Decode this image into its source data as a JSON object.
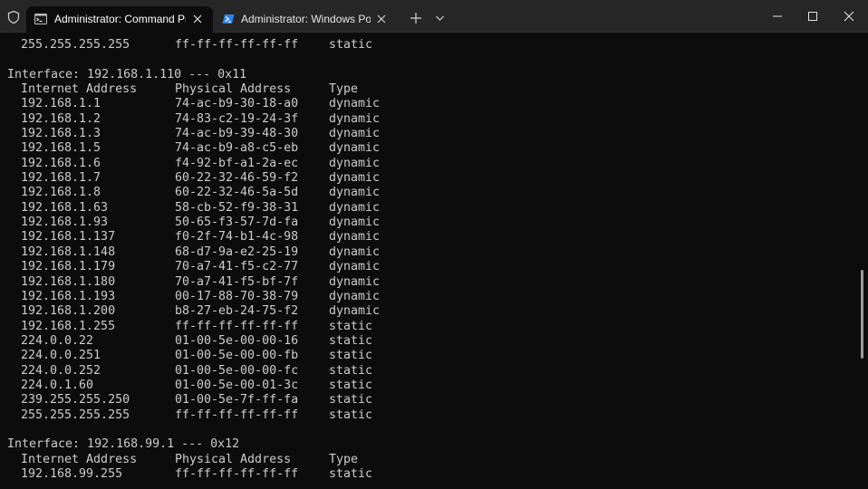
{
  "tabs": [
    {
      "title": "Administrator: Command Pro",
      "icon": "cmd-icon"
    },
    {
      "title": "Administrator: Windows PowerShell",
      "icon": "powershell-icon"
    }
  ],
  "terminal": {
    "lines": [
      {
        "type": "row",
        "cells": [
          "255.255.255.255",
          "ff-ff-ff-ff-ff-ff",
          "static"
        ]
      },
      {
        "type": "blank"
      },
      {
        "type": "text",
        "text": "Interface: 192.168.1.110 --- 0x11"
      },
      {
        "type": "row",
        "cells": [
          "Internet Address",
          "Physical Address",
          "Type"
        ]
      },
      {
        "type": "row",
        "cells": [
          "192.168.1.1",
          "74-ac-b9-30-18-a0",
          "dynamic"
        ]
      },
      {
        "type": "row",
        "cells": [
          "192.168.1.2",
          "74-83-c2-19-24-3f",
          "dynamic"
        ]
      },
      {
        "type": "row",
        "cells": [
          "192.168.1.3",
          "74-ac-b9-39-48-30",
          "dynamic"
        ]
      },
      {
        "type": "row",
        "cells": [
          "192.168.1.5",
          "74-ac-b9-a8-c5-eb",
          "dynamic"
        ]
      },
      {
        "type": "row",
        "cells": [
          "192.168.1.6",
          "f4-92-bf-a1-2a-ec",
          "dynamic"
        ]
      },
      {
        "type": "row",
        "cells": [
          "192.168.1.7",
          "60-22-32-46-59-f2",
          "dynamic"
        ]
      },
      {
        "type": "row",
        "cells": [
          "192.168.1.8",
          "60-22-32-46-5a-5d",
          "dynamic"
        ]
      },
      {
        "type": "row",
        "cells": [
          "192.168.1.63",
          "58-cb-52-f9-38-31",
          "dynamic"
        ]
      },
      {
        "type": "row",
        "cells": [
          "192.168.1.93",
          "50-65-f3-57-7d-fa",
          "dynamic"
        ]
      },
      {
        "type": "row",
        "cells": [
          "192.168.1.137",
          "f0-2f-74-b1-4c-98",
          "dynamic"
        ]
      },
      {
        "type": "row",
        "cells": [
          "192.168.1.148",
          "68-d7-9a-e2-25-19",
          "dynamic"
        ]
      },
      {
        "type": "row",
        "cells": [
          "192.168.1.179",
          "70-a7-41-f5-c2-77",
          "dynamic"
        ]
      },
      {
        "type": "row",
        "cells": [
          "192.168.1.180",
          "70-a7-41-f5-bf-7f",
          "dynamic"
        ]
      },
      {
        "type": "row",
        "cells": [
          "192.168.1.193",
          "00-17-88-70-38-79",
          "dynamic"
        ]
      },
      {
        "type": "row",
        "cells": [
          "192.168.1.200",
          "b8-27-eb-24-75-f2",
          "dynamic"
        ]
      },
      {
        "type": "row",
        "cells": [
          "192.168.1.255",
          "ff-ff-ff-ff-ff-ff",
          "static"
        ]
      },
      {
        "type": "row",
        "cells": [
          "224.0.0.22",
          "01-00-5e-00-00-16",
          "static"
        ]
      },
      {
        "type": "row",
        "cells": [
          "224.0.0.251",
          "01-00-5e-00-00-fb",
          "static"
        ]
      },
      {
        "type": "row",
        "cells": [
          "224.0.0.252",
          "01-00-5e-00-00-fc",
          "static"
        ]
      },
      {
        "type": "row",
        "cells": [
          "224.0.1.60",
          "01-00-5e-00-01-3c",
          "static"
        ]
      },
      {
        "type": "row",
        "cells": [
          "239.255.255.250",
          "01-00-5e-7f-ff-fa",
          "static"
        ]
      },
      {
        "type": "row",
        "cells": [
          "255.255.255.255",
          "ff-ff-ff-ff-ff-ff",
          "static"
        ]
      },
      {
        "type": "blank"
      },
      {
        "type": "text",
        "text": "Interface: 192.168.99.1 --- 0x12"
      },
      {
        "type": "row",
        "cells": [
          "Internet Address",
          "Physical Address",
          "Type"
        ]
      },
      {
        "type": "row",
        "cells": [
          "192.168.99.255",
          "ff-ff-ff-ff-ff-ff",
          "static"
        ]
      }
    ]
  },
  "colors": {
    "background": "#0c0c0c",
    "titlebar": "#262626",
    "text": "#cccccc",
    "powershell_icon": "#2f80ed"
  }
}
